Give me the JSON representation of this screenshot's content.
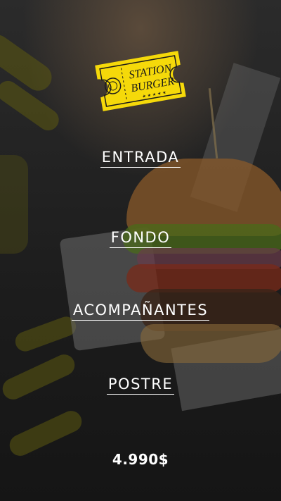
{
  "brand": {
    "logo_line1": "STATION",
    "logo_line2": "BURGER",
    "logo_color": "#f5d90a"
  },
  "menu": {
    "items": [
      {
        "label": "ENTRADA"
      },
      {
        "label": "FONDO"
      },
      {
        "label": "ACOMPAÑANTES"
      },
      {
        "label": "POSTRE"
      }
    ]
  },
  "price": "4.990$",
  "colors": {
    "text": "#ffffff",
    "accent": "#f5d90a"
  }
}
